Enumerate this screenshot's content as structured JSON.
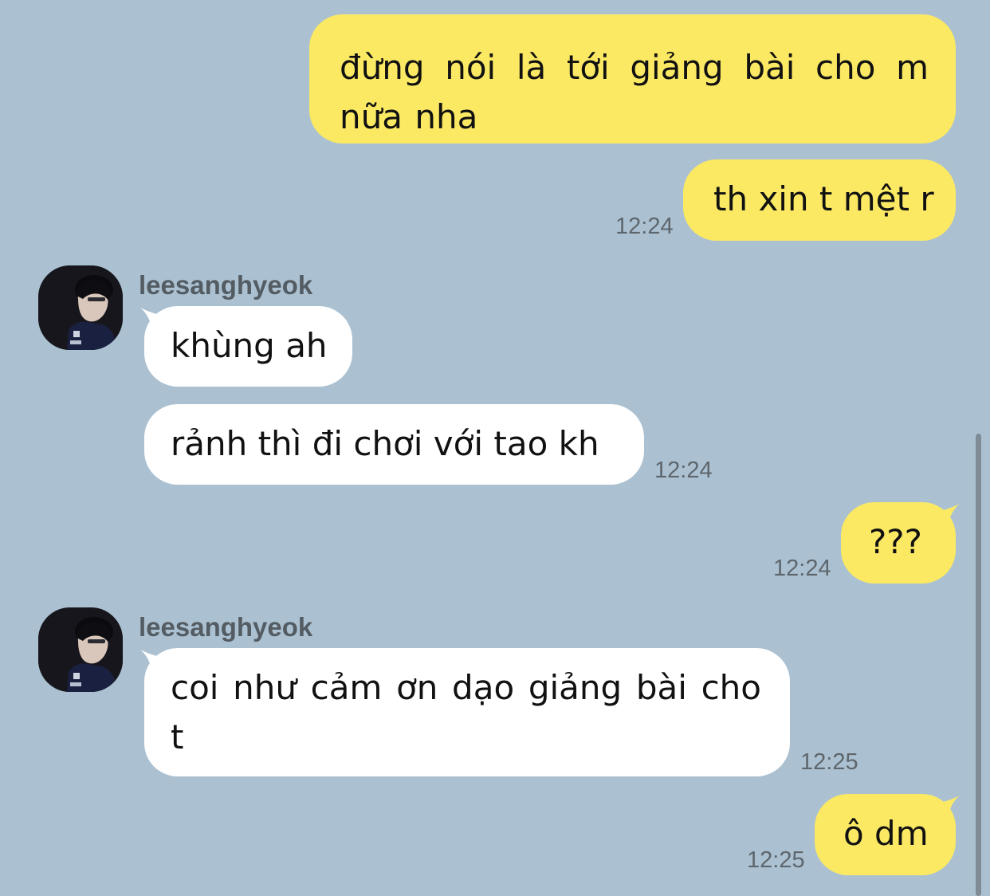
{
  "chat": {
    "messages": [
      {
        "from": "me",
        "text": "đừng nói là tới giảng bài cho m nữa nha"
      },
      {
        "from": "me",
        "text": "th xin t mệt r",
        "time": "12:24"
      },
      {
        "from": "other",
        "sender": "leesanghyeok",
        "text": "khùng ah"
      },
      {
        "from": "other",
        "text": "rảnh thì đi chơi với tao kh",
        "time": "12:24"
      },
      {
        "from": "me",
        "text": "???",
        "time": "12:24"
      },
      {
        "from": "other",
        "sender": "leesanghyeok",
        "text": "coi như cảm ơn dạo giảng bài cho t",
        "time": "12:25"
      },
      {
        "from": "me",
        "text": "ô dm",
        "time": "12:25"
      }
    ]
  },
  "colors": {
    "background": "#abc1d1",
    "my_bubble": "#fbe964",
    "other_bubble": "#ffffff",
    "timestamp": "#5e666d",
    "sender_name": "#545c63"
  },
  "icons": {
    "avatar": "profile-photo-avatar"
  }
}
